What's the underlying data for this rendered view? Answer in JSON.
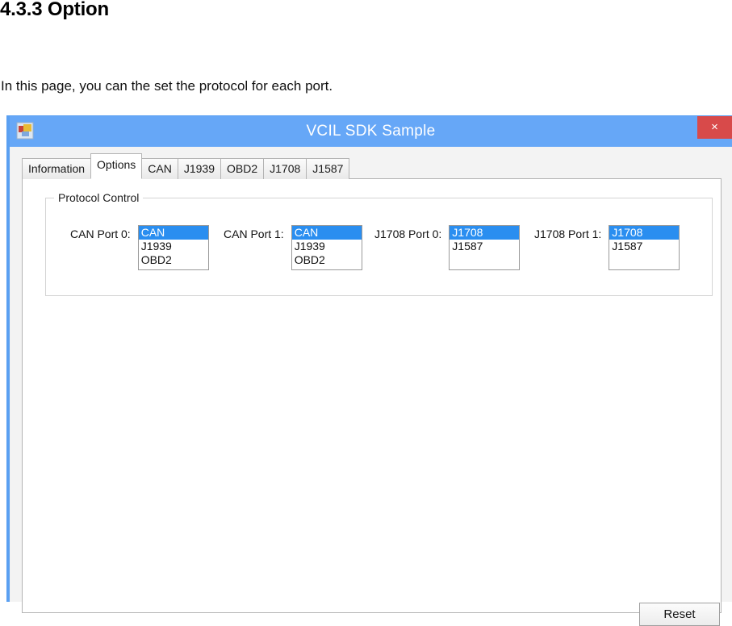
{
  "document": {
    "heading": "4.3.3 Option",
    "paragraph": "In this page, you can the set the protocol for each port."
  },
  "window": {
    "title": "VCIL SDK Sample",
    "icon": "application-icon",
    "close_label": "×"
  },
  "tabs": [
    {
      "label": "Information",
      "active": false
    },
    {
      "label": "Options",
      "active": true
    },
    {
      "label": "CAN",
      "active": false
    },
    {
      "label": "J1939",
      "active": false
    },
    {
      "label": "OBD2",
      "active": false
    },
    {
      "label": "J1708",
      "active": false
    },
    {
      "label": "J1587",
      "active": false
    }
  ],
  "group": {
    "title": "Protocol Control"
  },
  "ports": [
    {
      "label": "CAN Port 0:",
      "options": [
        "CAN",
        "J1939",
        "OBD2"
      ],
      "selected": "CAN"
    },
    {
      "label": "CAN Port 1:",
      "options": [
        "CAN",
        "J1939",
        "OBD2"
      ],
      "selected": "CAN"
    },
    {
      "label": "J1708 Port 0:",
      "options": [
        "J1708",
        "J1587"
      ],
      "selected": "J1708"
    },
    {
      "label": "J1708 Port 1:",
      "options": [
        "J1708",
        "J1587"
      ],
      "selected": "J1708"
    }
  ],
  "buttons": {
    "reset_label": "Reset"
  },
  "colors": {
    "titlebar": "#66a7f7",
    "close_button": "#d84a4a",
    "selection": "#2a8ef0",
    "window_border": "#5aa0f2"
  }
}
